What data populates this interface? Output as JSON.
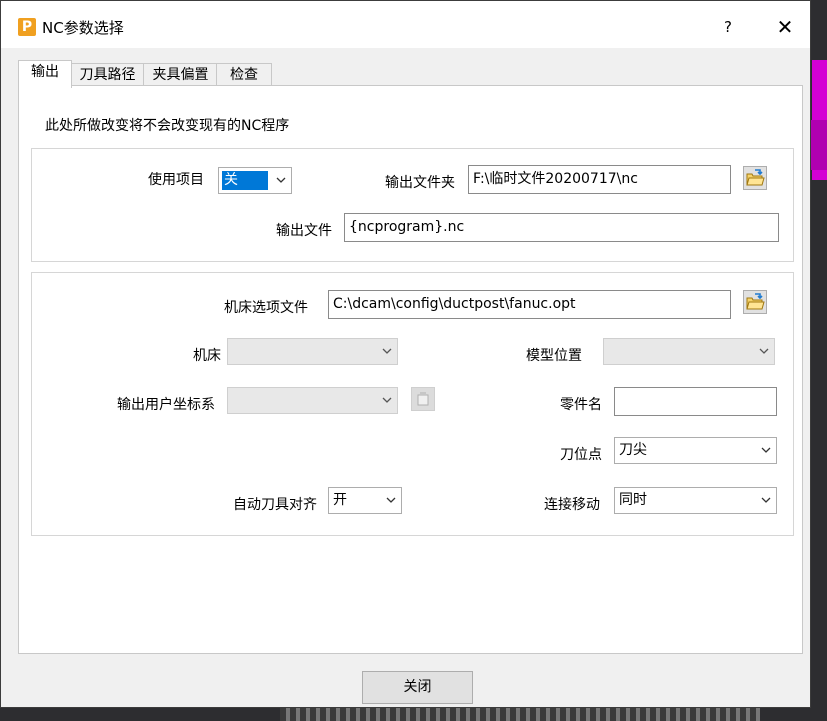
{
  "window": {
    "title": "NC参数选择",
    "help": "?",
    "close": "✕"
  },
  "tabs": [
    "输出",
    "刀具路径",
    "夹具偏置",
    "检查"
  ],
  "notice": "此处所做改变将不会改变现有的NC程序",
  "output_group": {
    "use_item_label": "使用项目",
    "use_item_value": "关",
    "output_folder_label": "输出文件夹",
    "output_folder_value": "F:\\临时文件20200717\\nc",
    "output_file_label": "输出文件",
    "output_file_value": "{ncprogram}.nc"
  },
  "machine_group": {
    "machine_option_file_label": "机床选项文件",
    "machine_option_file_value": "C:\\dcam\\config\\ductpost\\fanuc.opt",
    "machine_label": "机床",
    "machine_value": "",
    "model_position_label": "模型位置",
    "model_position_value": "",
    "output_ucs_label": "输出用户坐标系",
    "output_ucs_value": "",
    "part_name_label": "零件名",
    "part_name_value": "",
    "tool_point_label": "刀位点",
    "tool_point_value": "刀尖",
    "auto_tool_align_label": "自动刀具对齐",
    "auto_tool_align_value": "开",
    "connect_move_label": "连接移动",
    "connect_move_value": "同时"
  },
  "footer": {
    "close_label": "关闭"
  }
}
